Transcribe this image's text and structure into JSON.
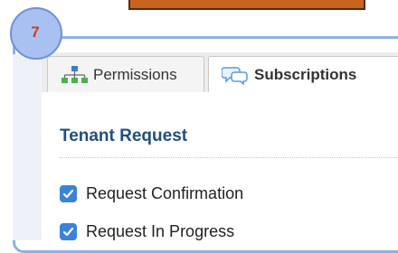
{
  "step_badge": {
    "number": "7"
  },
  "tabs": [
    {
      "label": "Permissions",
      "icon": "org-chart-icon",
      "active": false
    },
    {
      "label": "Subscriptions",
      "icon": "speech-bubbles-icon",
      "active": true
    }
  ],
  "section": {
    "title": "Tenant Request",
    "checkboxes": [
      {
        "label": "Request Confirmation",
        "checked": true
      },
      {
        "label": "Request In Progress",
        "checked": true
      }
    ]
  },
  "colors": {
    "badge_fill": "#a9c1f0",
    "badge_text": "#c8401a",
    "title_text": "#234f7c",
    "checkbox": "#3b82d9",
    "banner": "#c8641e"
  }
}
